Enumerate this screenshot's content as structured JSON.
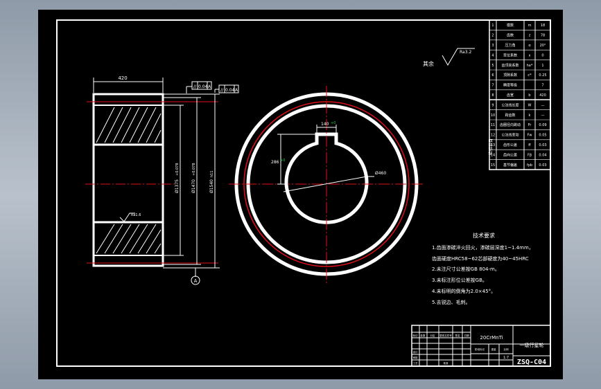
{
  "drawing": {
    "surface_finish": {
      "label": "其余",
      "value": "Ra3.2"
    },
    "tolerance_frames": [
      {
        "symbol": "//",
        "value": "0.04",
        "datum": "A"
      },
      {
        "symbol": "//",
        "value": "0.04",
        "datum": "A"
      }
    ],
    "datum_label": "A",
    "dimensions": {
      "width": "420",
      "key_width": "140",
      "key_tol": "+0",
      "key_depth": "286",
      "key_depth_tol": "+0",
      "bore": "Ø460",
      "dia_1": "Ø1375",
      "dia_1_tol": "+0.078",
      "dia_2": "Ø1470",
      "dia_2_tol": "+0.078",
      "dia_3": "Ø1540",
      "dia_3_tol": "h11",
      "roughness_small": "Ra1.6"
    },
    "tech_requirements": {
      "title": "技术要求",
      "items": [
        "1.齿面渗碳淬火回火，渗碳层深度1~1.4mm，",
        "  齿面硬度HRC58~62芯部硬度为40~45HRC",
        "2.未注尺寸公差按GB 804-m。",
        "3.未标注形位公差按GB。",
        "4.未标明的倒角为2.0×45°。",
        "5.去锐边、毛刺。"
      ]
    },
    "gear_table": {
      "rows": [
        [
          "1",
          "模数",
          "m",
          "18"
        ],
        [
          "2",
          "齿数",
          "z",
          "78"
        ],
        [
          "3",
          "压力角",
          "α",
          "20°"
        ],
        [
          "4",
          "变位系数",
          "x",
          "0"
        ],
        [
          "5",
          "齿顶高系数",
          "ha*",
          "1"
        ],
        [
          "6",
          "顶隙系数",
          "c*",
          "0.25"
        ],
        [
          "7",
          "精度等级",
          "",
          "7"
        ],
        [
          "8",
          "齿宽",
          "b",
          "420"
        ],
        [
          "9",
          "公法线长度",
          "W",
          "—"
        ],
        [
          "10",
          "跨齿数",
          "k",
          "—"
        ],
        [
          "11",
          "齿圈径向跳动",
          "Fr",
          "0.09"
        ],
        [
          "12",
          "公法线变动",
          "Fw",
          "0.05"
        ],
        [
          "13",
          "齿形公差",
          "ff",
          "0.03"
        ],
        [
          "14",
          "齿向公差",
          "Fβ",
          "0.04"
        ],
        [
          "15",
          "基节偏差",
          "fpb",
          "0.03"
        ]
      ],
      "side_label": "检验项目"
    },
    "title_block": {
      "material": "20CrMnTi",
      "part_name": "一级行星轮",
      "drawing_no": "ZSQ-C04",
      "scale": "1:7",
      "small_labels": [
        "标记",
        "处数",
        "分区",
        "更改文件号",
        "签名",
        "日期",
        "设计",
        "审核",
        "工艺",
        "批准",
        "阶段标记",
        "重量",
        "比例"
      ]
    }
  },
  "colors": {
    "background": "#000000",
    "line": "#ffffff",
    "center": "#e0101a",
    "green": "#18d24a",
    "outer": "#9aa4b0"
  }
}
